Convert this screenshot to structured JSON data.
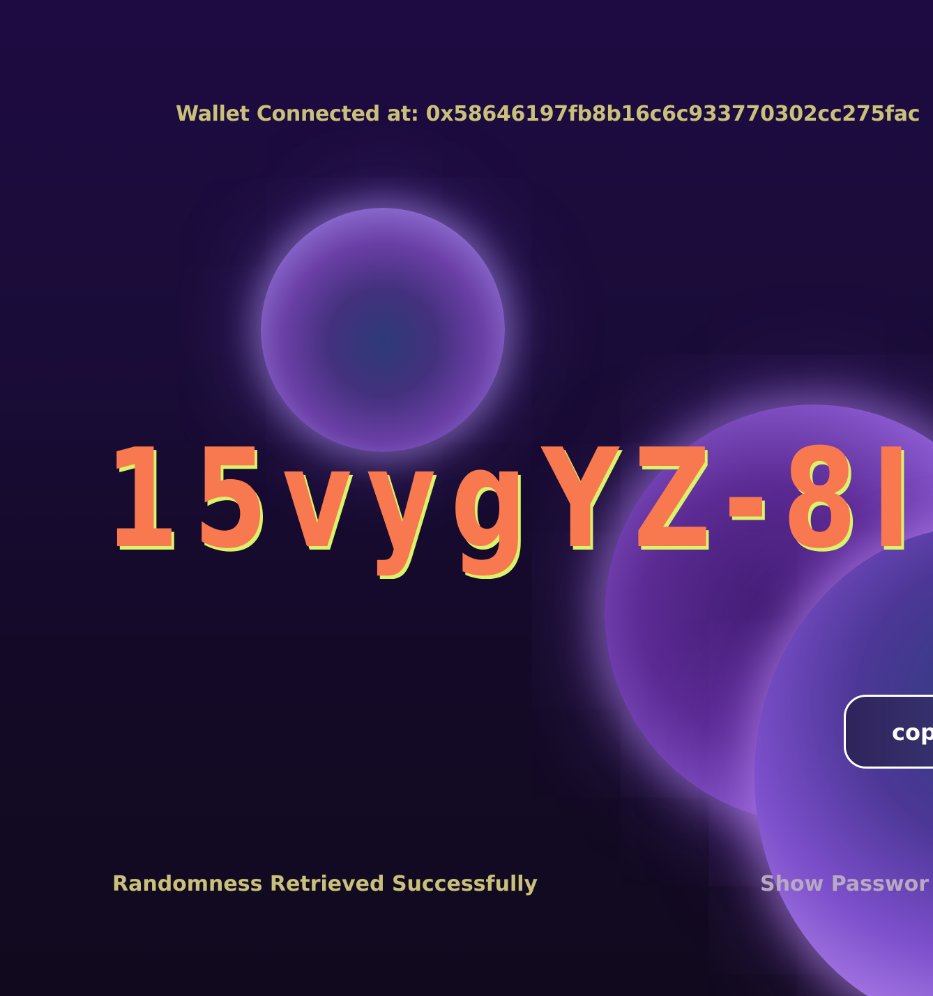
{
  "header": {
    "wallet_label": "Wallet Connected at:",
    "wallet_address": "0x58646197fb8b16c6c933770302cc275fac"
  },
  "generated_password": "15vygYZ-8I",
  "copy_button": {
    "label": "cop"
  },
  "footer": {
    "status_text": "Randomness Retrieved Successfully",
    "show_password_label": "Show Passwor"
  },
  "colors": {
    "background": "#1e0b42",
    "accent_text": "#c9c07a",
    "password_text": "#f8784f",
    "password_shadow": "#d9f36b",
    "orb_glow": "#a88de4"
  }
}
